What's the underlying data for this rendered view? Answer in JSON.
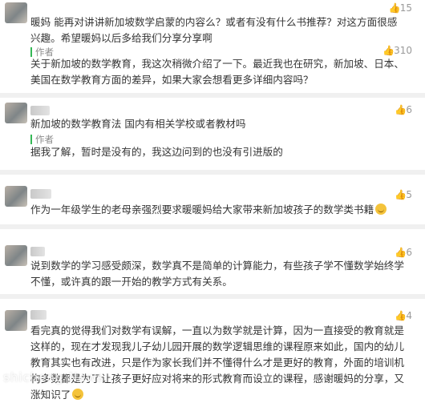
{
  "comments": [
    {
      "likes": "15",
      "text": "暖妈 能再对讲讲新加坡数学启蒙的内容么？或者有没有什么书推荐？对这方面很感兴趣。希望暖妈以后多给我们分享分享啊",
      "author_label": "作者",
      "author_likes": "310",
      "reply": "关于新加坡的数学教育，我这次稍微介绍了一下。最近我也在研究，新加坡、日本、美国在数学教育方面的差异，如果大家会想看更多详细内容吗？"
    },
    {
      "likes": "6",
      "text": "新加坡的数学教育法 国内有相关学校或者教材吗",
      "author_label": "作者",
      "reply": "据我了解，暂时是没有的，我这边问到的也没有引进版的"
    },
    {
      "likes": "5",
      "text": "作为一年级学生的老母亲强烈要求暖暖妈给大家带来新加坡孩子的数学类书籍"
    },
    {
      "likes": "6",
      "text": "说到数学的学习感受颇深，数学真不是简单的计算能力，有些孩子学不懂数学始终学不懂，或许真的跟一开始的教学方式有关系。"
    },
    {
      "likes": "4",
      "text": "看完真的觉得我们对数学有误解，一直以为数学就是计算，因为一直接受的教育就是这样的，现在才发现我儿子幼儿园开展的数学逻辑思维的课程原来如此，国内的幼儿教育其实也有改进，只是作为家长我们并不懂得什么才是更好的教育，外面的培训机构多数都是为了让孩子更好应对将来的形式教育而设立的课程，感谢暖妈的分享，又涨知识了"
    }
  ],
  "watermark": "shicheng News"
}
